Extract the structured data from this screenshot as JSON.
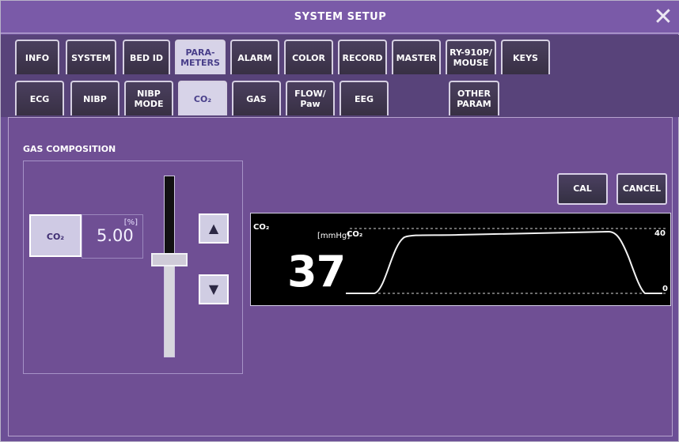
{
  "window": {
    "title": "SYSTEM SETUP",
    "close_icon": "close-icon"
  },
  "tabs_row1": [
    {
      "label": "INFO"
    },
    {
      "label": "SYSTEM"
    },
    {
      "label": "BED ID"
    },
    {
      "label": "PARA-\nMETERS",
      "active": true
    },
    {
      "label": "ALARM"
    },
    {
      "label": "COLOR"
    },
    {
      "label": "RECORD"
    },
    {
      "label": "MASTER"
    },
    {
      "label": "RY-910P/\nMOUSE"
    },
    {
      "label": "KEYS"
    }
  ],
  "tabs_row2": [
    {
      "label": "ECG"
    },
    {
      "label": "NIBP"
    },
    {
      "label": "NIBP\nMODE"
    },
    {
      "label": "CO₂",
      "active": true
    },
    {
      "label": "GAS"
    },
    {
      "label": "FLOW/\nPaw"
    },
    {
      "label": "EEG"
    },
    {
      "label": "OTHER\nPARAM"
    }
  ],
  "gas_composition": {
    "section_label": "GAS COMPOSITION",
    "button_label": "CO₂",
    "unit": "[%]",
    "value": "5.00"
  },
  "actions": {
    "cal": "CAL",
    "cancel": "CANCEL"
  },
  "waveform": {
    "param_label": "CO₂",
    "unit": "[mmHg]",
    "trace_label": "CO₂",
    "current_value": "37",
    "scale_top": "40",
    "scale_bottom": "0"
  },
  "colors": {
    "accent": "#6c4f96",
    "tab_active": "#d7d3e8"
  }
}
